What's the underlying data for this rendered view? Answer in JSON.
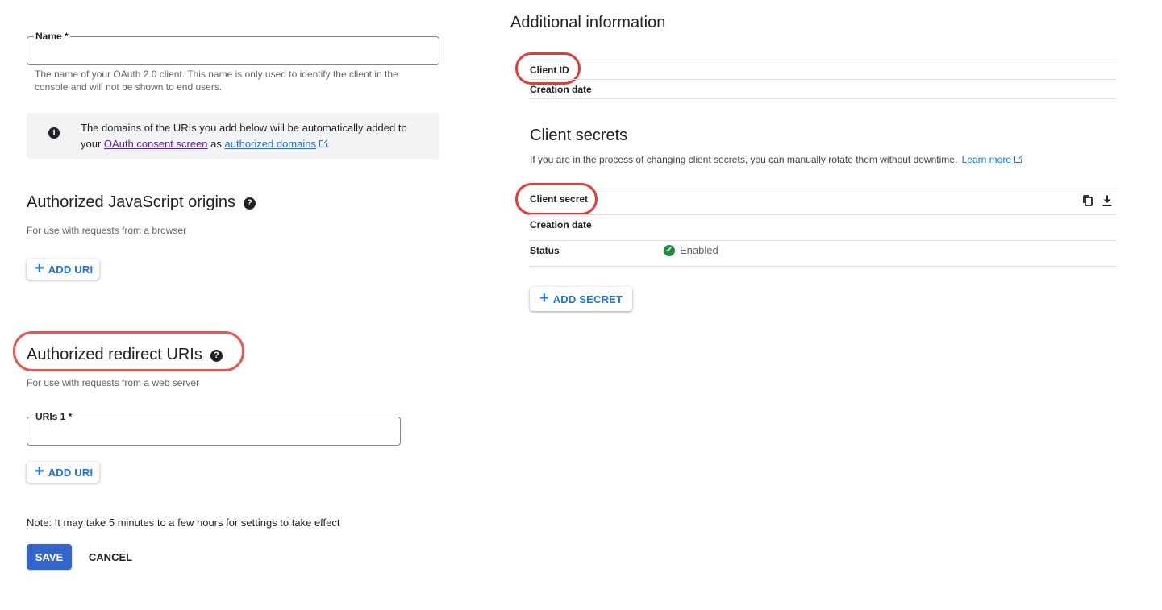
{
  "name_field": {
    "label": "Name *",
    "value": "",
    "helper": "The name of your OAuth 2.0 client. This name is only used to identify the client in the console and will not be shown to end users."
  },
  "info_box": {
    "text_before": "The domains of the URIs you add below will be automatically added to your ",
    "link1": "OAuth consent screen",
    "text_middle": " as ",
    "link2": "authorized domains",
    "text_after": "."
  },
  "js_origins": {
    "title": "Authorized JavaScript origins",
    "subtitle": "For use with requests from a browser",
    "add_label": "ADD URI"
  },
  "redirect_uris": {
    "title": "Authorized redirect URIs",
    "subtitle": "For use with requests from a web server",
    "field_label": "URIs 1 *",
    "field_value": "",
    "add_label": "ADD URI"
  },
  "note": "Note: It may take 5 minutes to a few hours for settings to take effect",
  "actions": {
    "save": "SAVE",
    "cancel": "CANCEL"
  },
  "additional_info": {
    "title": "Additional information",
    "client_id_label": "Client ID",
    "creation_date_label": "Creation date"
  },
  "client_secrets": {
    "title": "Client secrets",
    "description": "If you are in the process of changing client secrets, you can manually rotate them without downtime.",
    "learn_more": "Learn more",
    "secret_label": "Client secret",
    "creation_date_label": "Creation date",
    "status_label": "Status",
    "status_value": "Enabled",
    "add_label": "ADD SECRET"
  },
  "icons": {
    "info": "info-icon",
    "help": "help-icon",
    "copy": "copy-icon",
    "download": "download-icon",
    "check": "check-circle-icon",
    "external": "external-link-icon"
  },
  "colors": {
    "accent": "#1a73e8",
    "save_button": "#3366cc",
    "annotation": "#e53935",
    "enabled": "#1e8e3e"
  }
}
